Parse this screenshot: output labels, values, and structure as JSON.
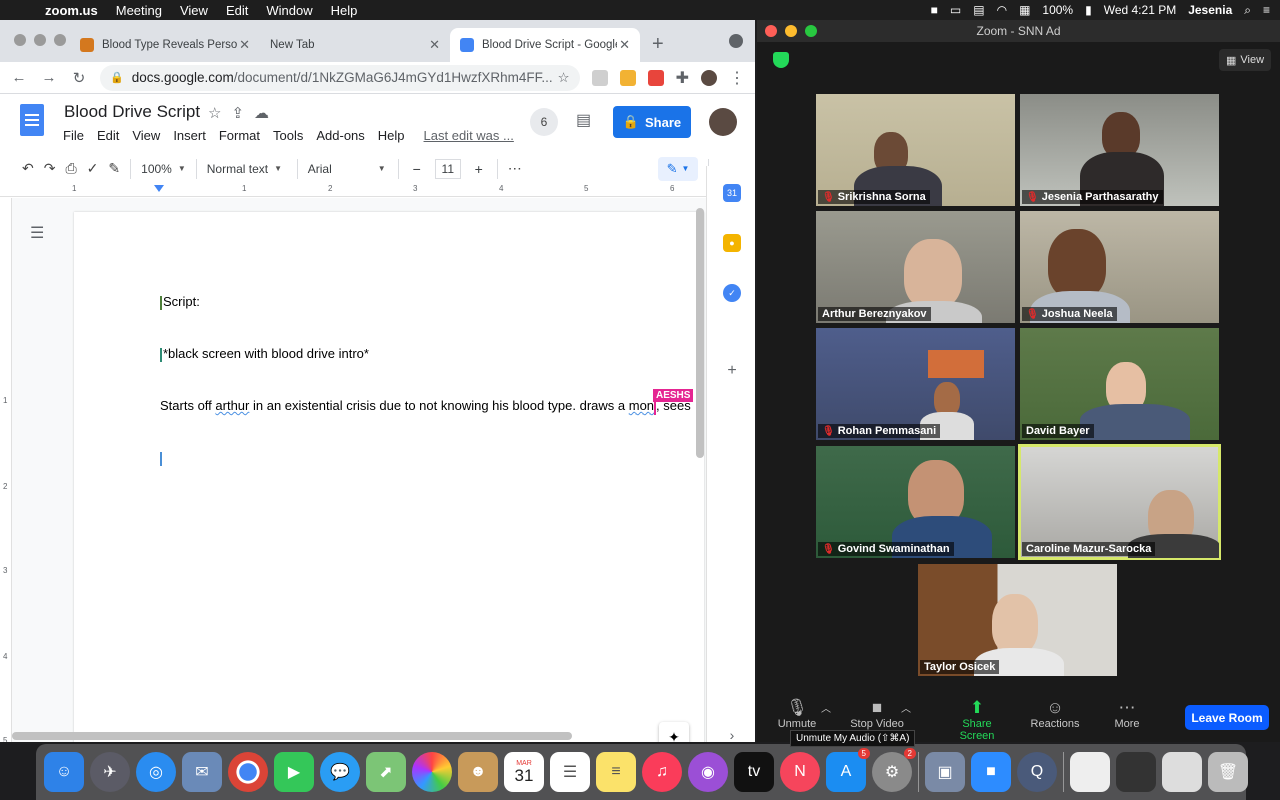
{
  "menubar": {
    "app": "zoom.us",
    "items": [
      "Meeting",
      "View",
      "Edit",
      "Window",
      "Help"
    ],
    "battery": "100%",
    "datetime": "Wed 4:21 PM",
    "user": "Jesenia"
  },
  "chrome": {
    "tabs": [
      {
        "title": "Blood Type Reveals Person",
        "color": "#d4781e",
        "active": false
      },
      {
        "title": "New Tab",
        "color": "",
        "active": false
      },
      {
        "title": "Blood Drive Script - Google",
        "color": "#4285f4",
        "active": true
      }
    ],
    "url_host": "docs.google.com",
    "url_path": "/document/d/1NkZGMaG6J4mGYd1HwzfXRhm4FF..."
  },
  "docs": {
    "title": "Blood Drive Script",
    "menu": [
      "File",
      "Edit",
      "View",
      "Insert",
      "Format",
      "Tools",
      "Add-ons",
      "Help"
    ],
    "last_edit": "Last edit was ...",
    "viewer_count": "6",
    "share_label": "Share",
    "toolbar": {
      "zoom": "100%",
      "style": "Normal text",
      "font": "Arial",
      "font_size": "11"
    },
    "ruler_labels": [
      "1",
      "1",
      "2",
      "3",
      "4",
      "5",
      "6"
    ],
    "vruler_labels": [
      "1",
      "2",
      "3",
      "4",
      "5"
    ],
    "paragraphs": {
      "p1": "Script:",
      "p2": "*black screen with blood drive intro*",
      "p3_a": "Starts off ",
      "p3_b": "arthur",
      "p3_c": " in an existential crisis due to not knowing his blood type. draws a ",
      "p3_d": "mon",
      "p3_e": ", sees"
    },
    "collab_label": "AESHS"
  },
  "zoom": {
    "window_title": "Zoom - SNN Ad",
    "view_label": "View",
    "participants": [
      {
        "name": "Srikrishna Sorna",
        "muted": true
      },
      {
        "name": "Jesenia Parthasarathy",
        "muted": true
      },
      {
        "name": "Arthur Bereznyakov",
        "muted": false
      },
      {
        "name": "Joshua Neela",
        "muted": true
      },
      {
        "name": "Rohan Pemmasani",
        "muted": true
      },
      {
        "name": "David Bayer",
        "muted": false
      },
      {
        "name": "Govind Swaminathan",
        "muted": true
      },
      {
        "name": "Caroline Mazur-Sarocka",
        "muted": false
      },
      {
        "name": "Taylor Osicek",
        "muted": false
      }
    ],
    "controls": {
      "unmute": "Unmute",
      "stop_video": "Stop Video",
      "share_screen": "Share Screen",
      "reactions": "Reactions",
      "more": "More",
      "leave": "Leave Room"
    },
    "tooltip": "Unmute My Audio (⇧⌘A)"
  },
  "dock": {
    "calendar_month": "MAR",
    "calendar_day": "31",
    "appstore_badge": "5",
    "settings_badge": "2"
  }
}
